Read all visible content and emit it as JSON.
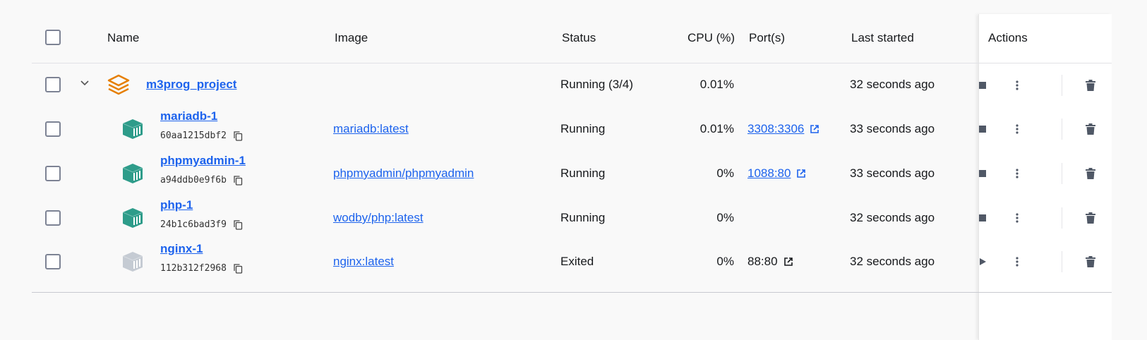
{
  "header": {
    "name": "Name",
    "image": "Image",
    "status": "Status",
    "cpu": "CPU (%)",
    "ports": "Port(s)",
    "last_started": "Last started",
    "actions": "Actions"
  },
  "project": {
    "name": "m3prog_project",
    "status": "Running (3/4)",
    "cpu": "0.01%",
    "last_started": "32 seconds ago",
    "icon": "stack-icon",
    "icon_color": "#e67e00"
  },
  "containers": [
    {
      "name": "mariadb-1",
      "id": "60aa1215dbf2",
      "image": "mariadb:latest",
      "status": "Running",
      "cpu": "0.01%",
      "port": "3308:3306",
      "port_link": true,
      "last_started": "33 seconds ago",
      "running": true
    },
    {
      "name": "phpmyadmin-1",
      "id": "a94ddb0e9f6b",
      "image": "phpmyadmin/phpmyadmin",
      "status": "Running",
      "cpu": "0%",
      "port": "1088:80",
      "port_link": true,
      "last_started": "33 seconds ago",
      "running": true
    },
    {
      "name": "php-1",
      "id": "24b1c6bad3f9",
      "image": "wodby/php:latest",
      "status": "Running",
      "cpu": "0%",
      "port": "",
      "port_link": false,
      "last_started": "32 seconds ago",
      "running": true
    },
    {
      "name": "nginx-1",
      "id": "112b312f2968",
      "image": "nginx:latest",
      "status": "Exited",
      "cpu": "0%",
      "port": "88:80",
      "port_link": false,
      "last_started": "32 seconds ago",
      "running": false
    }
  ],
  "colors": {
    "link": "#1d63ed",
    "container_running": "#2e9c8a",
    "container_exited": "#c5cbd3",
    "project": "#e67e00"
  }
}
